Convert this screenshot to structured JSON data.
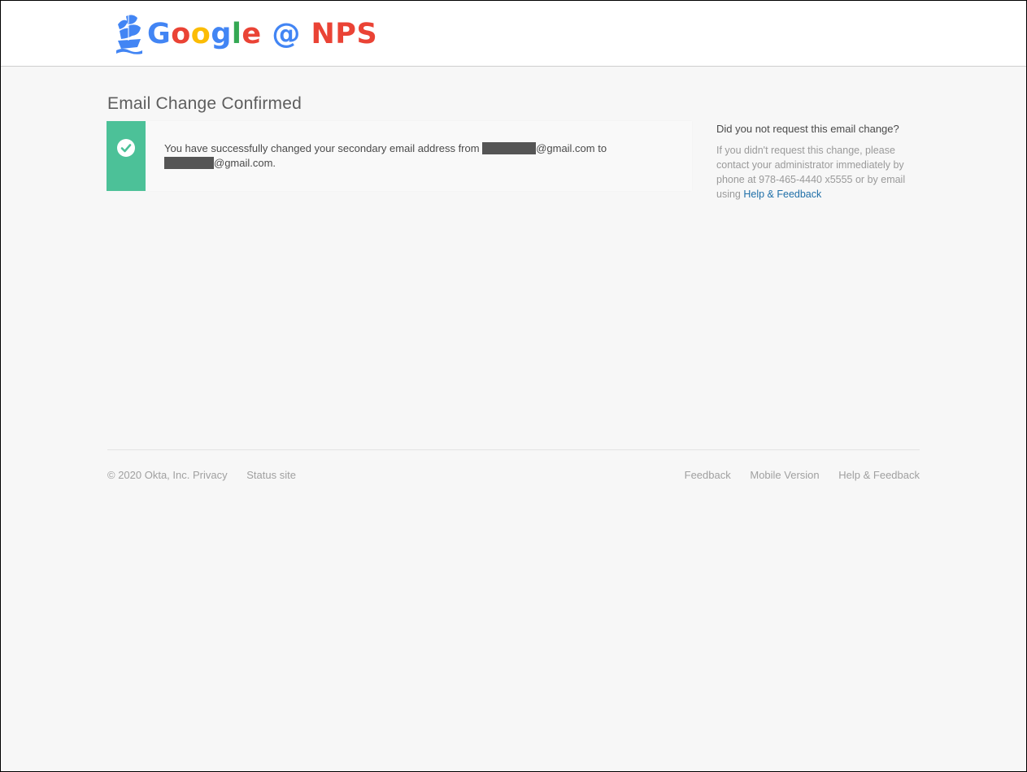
{
  "header": {
    "logo_parts": [
      {
        "text": "G",
        "color": "#4285f4"
      },
      {
        "text": "o",
        "color": "#ea4335"
      },
      {
        "text": "o",
        "color": "#fbbc05"
      },
      {
        "text": "g",
        "color": "#4285f4"
      },
      {
        "text": "l",
        "color": "#34a853"
      },
      {
        "text": "e",
        "color": "#ea4335"
      },
      {
        "text": " @ ",
        "color": "#4285f4"
      },
      {
        "text": "NPS",
        "color": "#ea4335"
      }
    ],
    "logo_icon": "ship-icon"
  },
  "page": {
    "title": "Email Change Confirmed"
  },
  "notice": {
    "status_color": "#4cc198",
    "icon": "check-circle-icon",
    "text_before": "You have successfully changed your secondary email address from ",
    "from_suffix": "@gmail.com to",
    "to_suffix": "@gmail.com."
  },
  "sidebar": {
    "title": "Did you not request this email change?",
    "body": "If you didn't request this change, please contact your administrator immediately by phone at 978-465-4440 x5555 or by email using ",
    "link_label": "Help & Feedback"
  },
  "footer": {
    "copyright": "© 2020 Okta, Inc.",
    "privacy_label": "Privacy",
    "status_label": "Status site",
    "feedback_label": "Feedback",
    "mobile_label": "Mobile Version",
    "help_label": "Help & Feedback"
  }
}
